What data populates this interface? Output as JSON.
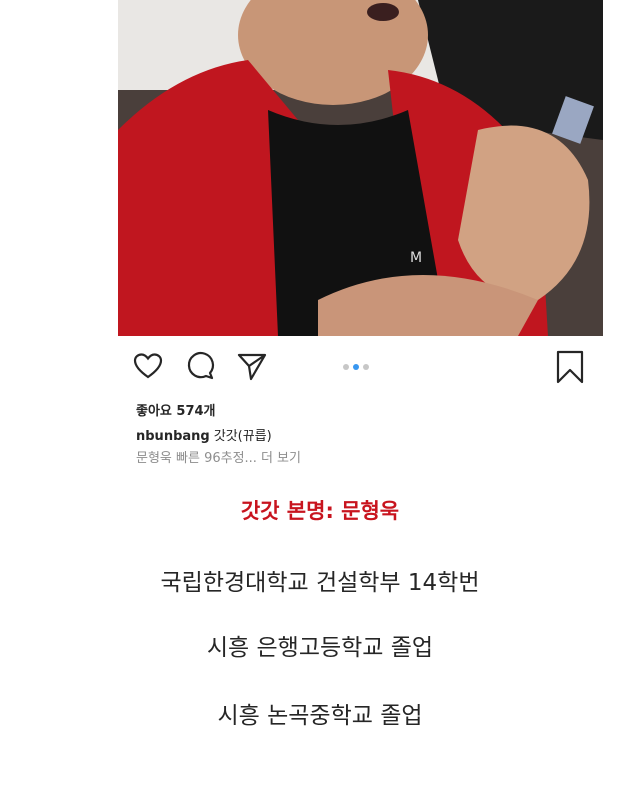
{
  "post": {
    "image_alt": "photo",
    "likes_label": "좋아요 574개",
    "username": "nbunbang",
    "caption_text": "갓갓(뀨릅)",
    "caption_second": "문형욱 빠른 96추정...",
    "more_label": "더 보기",
    "carousel": {
      "count": 3,
      "active_index": 1
    }
  },
  "overlay": {
    "headline": "갓갓 본명: 문형욱",
    "lines": [
      "국립한경대학교 건설학부 14학번",
      "시흥 은행고등학교 졸업",
      "시흥 논곡중학교 졸업"
    ]
  },
  "colors": {
    "headline": "#c8141e",
    "text": "#262626",
    "dot_active": "#3897f0",
    "dot_inactive": "#c7c7c7"
  },
  "icons": [
    "heart-icon",
    "comment-icon",
    "share-icon",
    "bookmark-icon"
  ]
}
